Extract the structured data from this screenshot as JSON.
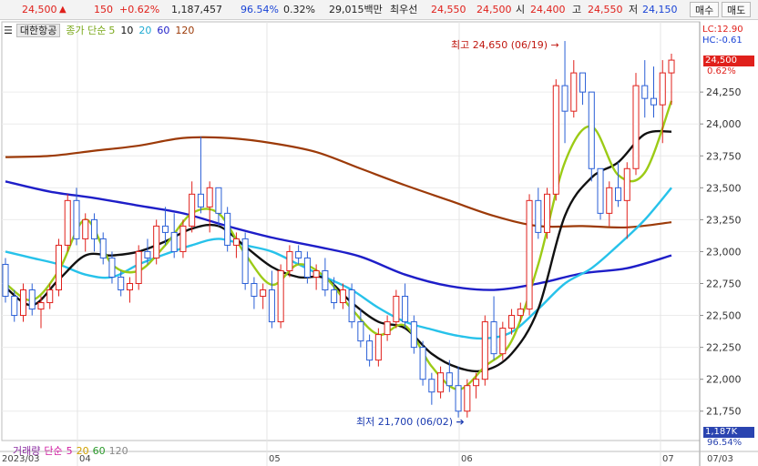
{
  "topbar": {
    "price": "24,500",
    "change_icon": "triangle-up-icon",
    "change": "150",
    "change_pct": "+0.62%",
    "volume": "1,187,457",
    "vol_ratio": "96.54%",
    "turnover": "0.32%",
    "amount": "29,015백만",
    "bid_label": "최우선",
    "best_ask": "24,550",
    "best_bid": "24,500",
    "open_label": "시",
    "open": "24,400",
    "high_label": "고",
    "high": "24,550",
    "low_label": "저",
    "low": "24,150",
    "buy_button": "매수",
    "sell_button": "매도"
  },
  "legend": {
    "stock_name": "대한항공",
    "ma_label": "종가 단순",
    "ma": [
      "5",
      "10",
      "20",
      "60",
      "120"
    ]
  },
  "right_panel": {
    "lc": "LC:12.90",
    "hc": "HC:-0.61",
    "price_box": "24,500",
    "price_pct": "0.62%",
    "volume_box": "1,187K",
    "volume_pct": "96.54%"
  },
  "annotations": {
    "high": "최고 24,650 (06/19)",
    "low": "최저 21,700 (06/02)"
  },
  "volume_legend": {
    "label": "거래량",
    "ma_label": "단순",
    "ma": [
      "5",
      "20",
      "60",
      "120"
    ]
  },
  "colors": {
    "up": "#e0201b",
    "down": "#2a5fd6",
    "ma5": "#9ccb16",
    "ma10": "#111111",
    "ma20": "#27c2ea",
    "ma60": "#1e1ec8",
    "ma120": "#9c3a08"
  },
  "chart_data": {
    "type": "candlestick",
    "x_labels": [
      "2023/03",
      "04",
      "05",
      "06",
      "07"
    ],
    "y_ticks": [
      "24,250",
      "24,000",
      "23,750",
      "23,500",
      "23,250",
      "23,000",
      "22,750",
      "22,500",
      "22,250",
      "22,000",
      "21,750"
    ],
    "x_end_label": "07/03",
    "ylim": [
      21520,
      24800
    ],
    "y_tick_values": [
      24250,
      24000,
      23750,
      23500,
      23250,
      23000,
      22750,
      22500,
      22250,
      22000,
      21750
    ],
    "ohlc": [
      [
        22900,
        22950,
        22600,
        22650
      ],
      [
        22650,
        22700,
        22450,
        22500
      ],
      [
        22500,
        22750,
        22450,
        22700
      ],
      [
        22700,
        22750,
        22500,
        22550
      ],
      [
        22550,
        22650,
        22400,
        22600
      ],
      [
        22600,
        22750,
        22550,
        22700
      ],
      [
        22700,
        23100,
        22650,
        23050
      ],
      [
        23050,
        23450,
        23000,
        23400
      ],
      [
        23400,
        23500,
        23050,
        23100
      ],
      [
        23100,
        23300,
        23000,
        23250
      ],
      [
        23250,
        23300,
        23000,
        23100
      ],
      [
        23100,
        23150,
        22900,
        22950
      ],
      [
        22950,
        23000,
        22750,
        22800
      ],
      [
        22800,
        22850,
        22650,
        22700
      ],
      [
        22700,
        22800,
        22600,
        22750
      ],
      [
        22750,
        23050,
        22700,
        23000
      ],
      [
        23000,
        23100,
        22900,
        22950
      ],
      [
        22950,
        23250,
        22900,
        23200
      ],
      [
        23200,
        23350,
        23050,
        23150
      ],
      [
        23150,
        23300,
        22950,
        23000
      ],
      [
        23000,
        23250,
        22950,
        23200
      ],
      [
        23200,
        23550,
        23150,
        23450
      ],
      [
        23450,
        23900,
        23300,
        23350
      ],
      [
        23350,
        23550,
        23150,
        23500
      ],
      [
        23500,
        23500,
        23200,
        23300
      ],
      [
        23300,
        23350,
        23000,
        23050
      ],
      [
        23050,
        23150,
        22950,
        23100
      ],
      [
        23100,
        23150,
        22700,
        22750
      ],
      [
        22750,
        22800,
        22550,
        22650
      ],
      [
        22650,
        22750,
        22550,
        22700
      ],
      [
        22700,
        22850,
        22400,
        22450
      ],
      [
        22450,
        22900,
        22400,
        22850
      ],
      [
        22850,
        23050,
        22800,
        23000
      ],
      [
        23000,
        23050,
        22900,
        22950
      ],
      [
        22950,
        23000,
        22750,
        22800
      ],
      [
        22800,
        22900,
        22700,
        22850
      ],
      [
        22850,
        22950,
        22650,
        22700
      ],
      [
        22700,
        22800,
        22550,
        22600
      ],
      [
        22600,
        22750,
        22550,
        22700
      ],
      [
        22700,
        22750,
        22400,
        22450
      ],
      [
        22450,
        22550,
        22250,
        22300
      ],
      [
        22300,
        22350,
        22100,
        22150
      ],
      [
        22150,
        22400,
        22100,
        22350
      ],
      [
        22350,
        22500,
        22300,
        22450
      ],
      [
        22450,
        22700,
        22400,
        22650
      ],
      [
        22650,
        22750,
        22400,
        22450
      ],
      [
        22450,
        22500,
        22200,
        22250
      ],
      [
        22250,
        22300,
        21950,
        22000
      ],
      [
        22000,
        22050,
        21800,
        21900
      ],
      [
        21900,
        22100,
        21850,
        22050
      ],
      [
        22050,
        22150,
        21900,
        21950
      ],
      [
        21950,
        22100,
        21700,
        21750
      ],
      [
        21750,
        22000,
        21700,
        21950
      ],
      [
        21950,
        22050,
        21850,
        22000
      ],
      [
        22000,
        22500,
        21950,
        22450
      ],
      [
        22450,
        22650,
        22150,
        22200
      ],
      [
        22200,
        22450,
        22150,
        22400
      ],
      [
        22400,
        22550,
        22350,
        22500
      ],
      [
        22500,
        22600,
        22450,
        22550
      ],
      [
        22550,
        23450,
        22500,
        23400
      ],
      [
        23400,
        23500,
        23100,
        23150
      ],
      [
        23150,
        23500,
        23100,
        23450
      ],
      [
        23450,
        24350,
        23400,
        24300
      ],
      [
        24300,
        24650,
        23850,
        24100
      ],
      [
        24100,
        24500,
        24050,
        24400
      ],
      [
        24400,
        24400,
        24150,
        24250
      ],
      [
        24250,
        24250,
        23550,
        23650
      ],
      [
        23650,
        23650,
        23250,
        23300
      ],
      [
        23300,
        23550,
        23200,
        23500
      ],
      [
        23500,
        23700,
        23350,
        23400
      ],
      [
        23400,
        23700,
        23100,
        23650
      ],
      [
        23650,
        24400,
        23600,
        24300
      ],
      [
        24300,
        24500,
        24050,
        24200
      ],
      [
        24200,
        24450,
        24050,
        24150
      ],
      [
        24150,
        24500,
        23850,
        24400
      ],
      [
        24400,
        24550,
        24150,
        24500
      ]
    ],
    "moving_averages": {
      "ma5": [
        [
          0,
          22750
        ],
        [
          3,
          22620
        ],
        [
          6,
          22850
        ],
        [
          9,
          23250
        ],
        [
          12,
          22900
        ],
        [
          15,
          22850
        ],
        [
          18,
          23050
        ],
        [
          21,
          23300
        ],
        [
          24,
          23300
        ],
        [
          27,
          22980
        ],
        [
          30,
          22740
        ],
        [
          33,
          22900
        ],
        [
          36,
          22800
        ],
        [
          39,
          22550
        ],
        [
          42,
          22350
        ],
        [
          45,
          22420
        ],
        [
          48,
          22100
        ],
        [
          51,
          21920
        ],
        [
          54,
          22100
        ],
        [
          57,
          22300
        ],
        [
          60,
          22900
        ],
        [
          63,
          23700
        ],
        [
          66,
          23980
        ],
        [
          69,
          23600
        ],
        [
          72,
          23620
        ],
        [
          75,
          24180
        ]
      ],
      "ma10": [
        [
          0,
          22720
        ],
        [
          3,
          22580
        ],
        [
          6,
          22780
        ],
        [
          9,
          22970
        ],
        [
          12,
          22970
        ],
        [
          15,
          23000
        ],
        [
          18,
          23080
        ],
        [
          21,
          23180
        ],
        [
          24,
          23200
        ],
        [
          27,
          23040
        ],
        [
          30,
          22880
        ],
        [
          33,
          22800
        ],
        [
          36,
          22790
        ],
        [
          39,
          22600
        ],
        [
          42,
          22450
        ],
        [
          45,
          22400
        ],
        [
          48,
          22200
        ],
        [
          51,
          22090
        ],
        [
          54,
          22070
        ],
        [
          57,
          22200
        ],
        [
          60,
          22550
        ],
        [
          63,
          23280
        ],
        [
          66,
          23580
        ],
        [
          69,
          23700
        ],
        [
          72,
          23920
        ],
        [
          75,
          23940
        ]
      ],
      "ma20": [
        [
          0,
          23000
        ],
        [
          3,
          22950
        ],
        [
          6,
          22900
        ],
        [
          9,
          22820
        ],
        [
          12,
          22800
        ],
        [
          15,
          22900
        ],
        [
          18,
          22980
        ],
        [
          21,
          23050
        ],
        [
          24,
          23100
        ],
        [
          27,
          23050
        ],
        [
          30,
          23000
        ],
        [
          33,
          22900
        ],
        [
          36,
          22800
        ],
        [
          39,
          22700
        ],
        [
          42,
          22560
        ],
        [
          45,
          22450
        ],
        [
          48,
          22390
        ],
        [
          51,
          22340
        ],
        [
          54,
          22320
        ],
        [
          57,
          22370
        ],
        [
          60,
          22550
        ],
        [
          63,
          22750
        ],
        [
          66,
          22870
        ],
        [
          69,
          23050
        ],
        [
          72,
          23250
        ],
        [
          75,
          23500
        ]
      ],
      "ma60": [
        [
          0,
          23550
        ],
        [
          5,
          23470
        ],
        [
          10,
          23420
        ],
        [
          15,
          23360
        ],
        [
          20,
          23300
        ],
        [
          25,
          23200
        ],
        [
          30,
          23110
        ],
        [
          35,
          23040
        ],
        [
          40,
          22960
        ],
        [
          45,
          22820
        ],
        [
          50,
          22730
        ],
        [
          55,
          22700
        ],
        [
          60,
          22750
        ],
        [
          65,
          22830
        ],
        [
          70,
          22870
        ],
        [
          75,
          22970
        ]
      ],
      "ma120": [
        [
          0,
          23740
        ],
        [
          5,
          23750
        ],
        [
          10,
          23790
        ],
        [
          15,
          23830
        ],
        [
          20,
          23890
        ],
        [
          25,
          23890
        ],
        [
          30,
          23850
        ],
        [
          35,
          23780
        ],
        [
          40,
          23650
        ],
        [
          45,
          23520
        ],
        [
          50,
          23400
        ],
        [
          55,
          23280
        ],
        [
          60,
          23200
        ],
        [
          65,
          23200
        ],
        [
          70,
          23190
        ],
        [
          75,
          23230
        ]
      ]
    }
  }
}
